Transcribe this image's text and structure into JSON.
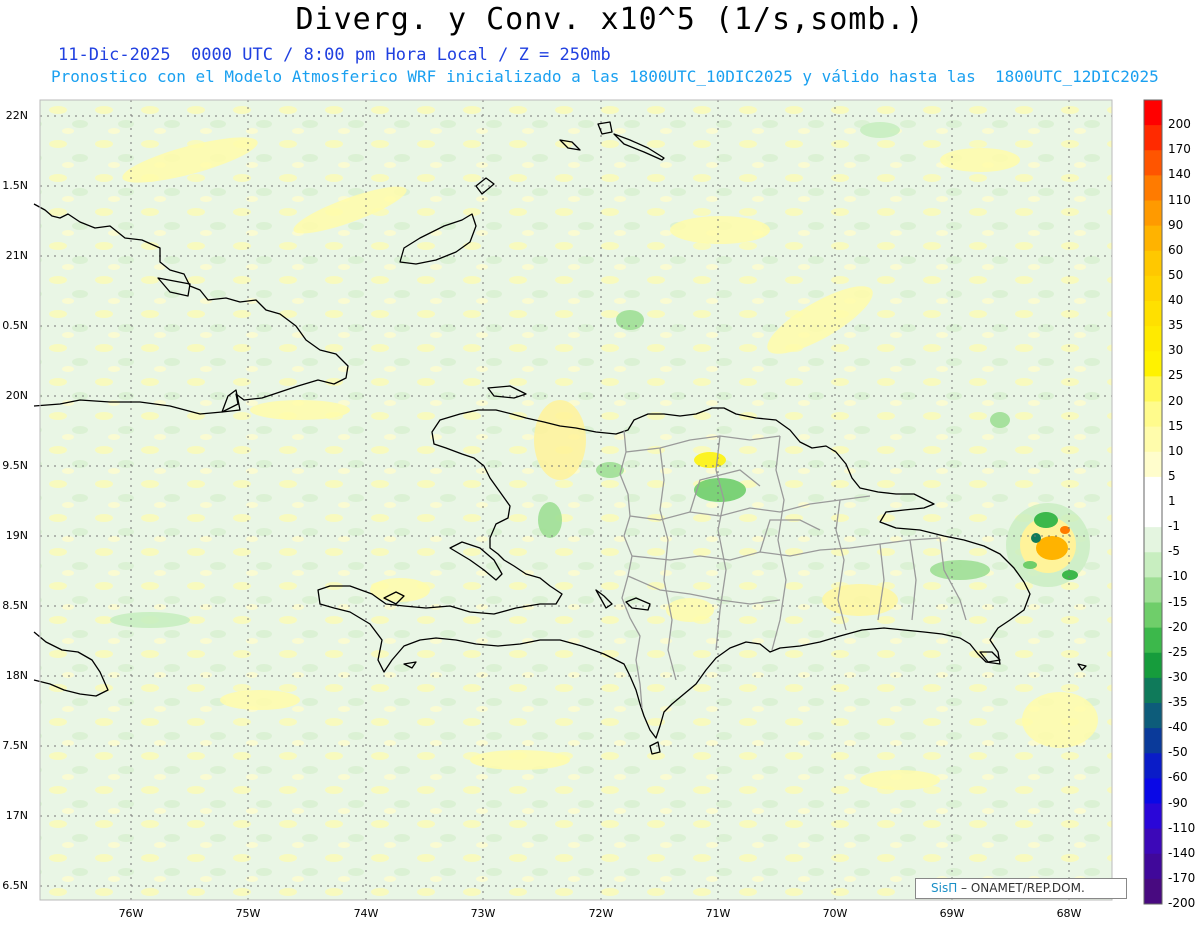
{
  "header": {
    "title": "Diverg. y Conv. x10^5 (1/s,somb.)",
    "subtitle_time": "11-Dic-2025  0000 UTC / 8:00 pm Hora Local / Z = 250mb",
    "subtitle_model": "Pronostico con el Modelo Atmosferico WRF inicializado a las 1800UTC_10DIC2025 y válido hasta las  1800UTC_12DIC2025"
  },
  "axes": {
    "lat_labels": [
      "22N",
      "1.5N",
      "21N",
      "0.5N",
      "20N",
      "9.5N",
      "19N",
      "8.5N",
      "18N",
      "7.5N",
      "17N",
      "6.5N"
    ],
    "lon_labels": [
      "76W",
      "75W",
      "74W",
      "73W",
      "72W",
      "71W",
      "70W",
      "69W",
      "68W"
    ]
  },
  "colorbar": {
    "labels": [
      "200",
      "170",
      "140",
      "110",
      "90",
      "60",
      "50",
      "40",
      "35",
      "30",
      "25",
      "20",
      "15",
      "10",
      "5",
      "1",
      "-1",
      "-5",
      "-10",
      "-15",
      "-20",
      "-25",
      "-30",
      "-35",
      "-40",
      "-50",
      "-60",
      "-90",
      "-110",
      "-140",
      "-170",
      "-200"
    ],
    "colors": [
      "#ff0000",
      "#ff2a00",
      "#ff5500",
      "#ff7b00",
      "#ff9a00",
      "#ffb300",
      "#ffc800",
      "#ffd400",
      "#ffe000",
      "#ffea00",
      "#fff200",
      "#fff85a",
      "#fffb8c",
      "#fffcab",
      "#fffdcc",
      "#ffffff",
      "#ffffff",
      "#e4f5e0",
      "#c8eec0",
      "#9fdf95",
      "#6fce6a",
      "#3cb84b",
      "#169c3c",
      "#0f7a5a",
      "#0d5c7a",
      "#0a3a9a",
      "#0a1cc8",
      "#0a08e6",
      "#2a06d8",
      "#3c08b8",
      "#40089a",
      "#480a80"
    ]
  },
  "credit": {
    "brand": "SisΠ",
    "text": " – ONAMET/REP.DOM."
  }
}
